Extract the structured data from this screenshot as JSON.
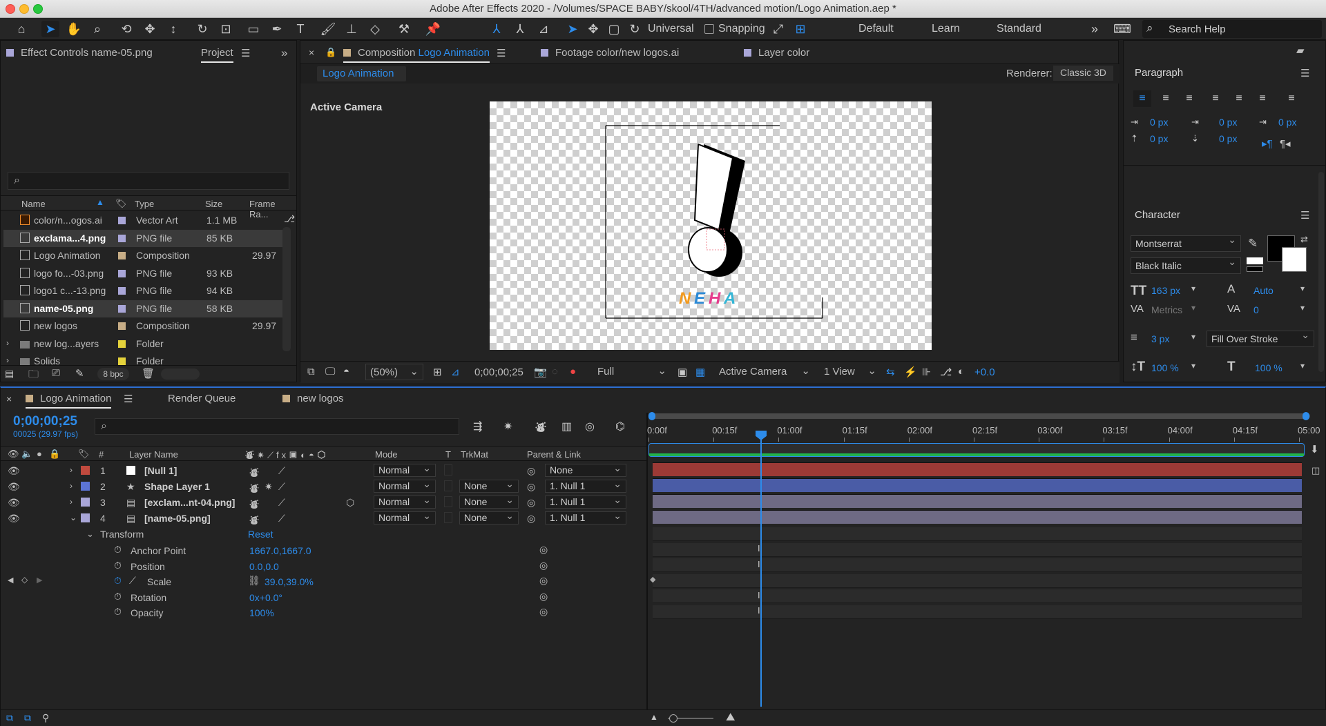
{
  "window": {
    "title": "Adobe After Effects 2020 - /Volumes/SPACE BABY/skool/4TH/advanced motion/Logo Animation.aep *"
  },
  "toolbar": {
    "universal_label": "Universal",
    "snapping_label": "Snapping",
    "workspaces": [
      "Default",
      "Learn",
      "Standard"
    ],
    "search_placeholder": "Search Help"
  },
  "left_panel": {
    "tab_effect_controls": "Effect Controls name-05.png",
    "tab_project": "Project",
    "search_icon": "⌕",
    "columns": {
      "name": "Name",
      "type": "Type",
      "size": "Size",
      "frame_rate": "Frame Ra..."
    },
    "items": [
      {
        "name": "color/n...ogos.ai",
        "type": "Vector Art",
        "size": "1.1 MB",
        "fps": "",
        "swatch": "#a9a6d8",
        "icon": "ai-file-icon"
      },
      {
        "name": "exclama...4.png",
        "type": "PNG file",
        "size": "85 KB",
        "fps": "",
        "swatch": "#a9a6d8",
        "icon": "png-file-icon"
      },
      {
        "name": "Logo Animation",
        "type": "Composition",
        "size": "",
        "fps": "29.97",
        "swatch": "#c7ad86",
        "icon": "composition-icon"
      },
      {
        "name": "logo fo...-03.png",
        "type": "PNG file",
        "size": "93 KB",
        "fps": "",
        "swatch": "#a9a6d8",
        "icon": "png-file-icon"
      },
      {
        "name": "logo1 c...-13.png",
        "type": "PNG file",
        "size": "94 KB",
        "fps": "",
        "swatch": "#a9a6d8",
        "icon": "png-file-icon"
      },
      {
        "name": "name-05.png",
        "type": "PNG file",
        "size": "58 KB",
        "fps": "",
        "swatch": "#a9a6d8",
        "icon": "png-file-icon"
      },
      {
        "name": "new logos",
        "type": "Composition",
        "size": "",
        "fps": "29.97",
        "swatch": "#c7ad86",
        "icon": "composition-icon"
      },
      {
        "name": "new log...ayers",
        "type": "Folder",
        "size": "",
        "fps": "",
        "swatch": "#e4d23b",
        "icon": "folder-icon"
      },
      {
        "name": "Solids",
        "type": "Folder",
        "size": "",
        "fps": "",
        "swatch": "#e4d23b",
        "icon": "folder-icon"
      }
    ],
    "bpc": "8 bpc"
  },
  "comp_panel": {
    "tab_composition_prefix": "Composition",
    "tab_composition_name": "Logo Animation",
    "tab_footage": "Footage color/new logos.ai",
    "tab_layer": "Layer color",
    "breadcrumb": "Logo Animation",
    "renderer_label": "Renderer:",
    "renderer_value": "Classic 3D",
    "active_camera_label": "Active Camera",
    "logo_text": [
      "N",
      "E",
      "H",
      "A"
    ],
    "logo_colors": [
      "#f29a1e",
      "#2c8ad6",
      "#e63b8c",
      "#34b6d6"
    ],
    "footer": {
      "zoom": "(50%)",
      "timecode": "0;00;00;25",
      "resolution": "Full",
      "camera": "Active Camera",
      "views": "1 View",
      "exposure": "+0.0"
    }
  },
  "paragraph_panel": {
    "title": "Paragraph",
    "indent_values": [
      "0 px",
      "0 px",
      "0 px",
      "0 px",
      "0 px"
    ]
  },
  "character_panel": {
    "title": "Character",
    "font_family": "Montserrat",
    "font_style": "Black Italic",
    "font_size": "163 px",
    "leading": "Auto",
    "kerning": "Metrics",
    "tracking": "0",
    "stroke_width": "3 px",
    "stroke_mode": "Fill Over Stroke",
    "vertical_scale": "100 %",
    "horizontal_scale": "100 %"
  },
  "timeline": {
    "tabs": [
      "Logo Animation",
      "Render Queue",
      "new logos"
    ],
    "timecode": "0;00;00;25",
    "frame_info": "00025 (29.97 fps)",
    "columns": {
      "num": "#",
      "layer_name": "Layer Name",
      "mode": "Mode",
      "t": "T",
      "trkmat": "TrkMat",
      "parent": "Parent & Link"
    },
    "layers": [
      {
        "num": "1",
        "name": "[Null 1]",
        "color": "#c14a3e",
        "mode": "Normal",
        "trkmat": "",
        "parent": "None",
        "icon": "null-icon",
        "bar": "#9c3a36"
      },
      {
        "num": "2",
        "name": "Shape Layer 1",
        "color": "#5c74d6",
        "mode": "Normal",
        "trkmat": "None",
        "parent": "1. Null 1",
        "icon": "star-shape-icon",
        "bar": "#4a5ca6"
      },
      {
        "num": "3",
        "name": "[exclam...nt-04.png]",
        "color": "#a9a6d8",
        "mode": "Normal",
        "trkmat": "None",
        "parent": "1. Null 1",
        "icon": "png-file-icon",
        "bar": "#6e6a84"
      },
      {
        "num": "4",
        "name": "[name-05.png]",
        "color": "#a9a6d8",
        "mode": "Normal",
        "trkmat": "None",
        "parent": "1. Null 1",
        "icon": "png-file-icon",
        "bar": "#6e6a84"
      }
    ],
    "transform": {
      "label": "Transform",
      "reset": "Reset",
      "properties": [
        {
          "name": "Anchor Point",
          "value": "1667.0,1667.0"
        },
        {
          "name": "Position",
          "value": "0.0,0.0"
        },
        {
          "name": "Scale",
          "value": "39.0,39.0%"
        },
        {
          "name": "Rotation",
          "value": "0x+0.0°"
        },
        {
          "name": "Opacity",
          "value": "100%"
        }
      ]
    },
    "ruler": [
      "0:00f",
      "00:15f",
      "01:00f",
      "01:15f",
      "02:00f",
      "02:15f",
      "03:00f",
      "03:15f",
      "04:00f",
      "04:15f",
      "05:00"
    ]
  }
}
